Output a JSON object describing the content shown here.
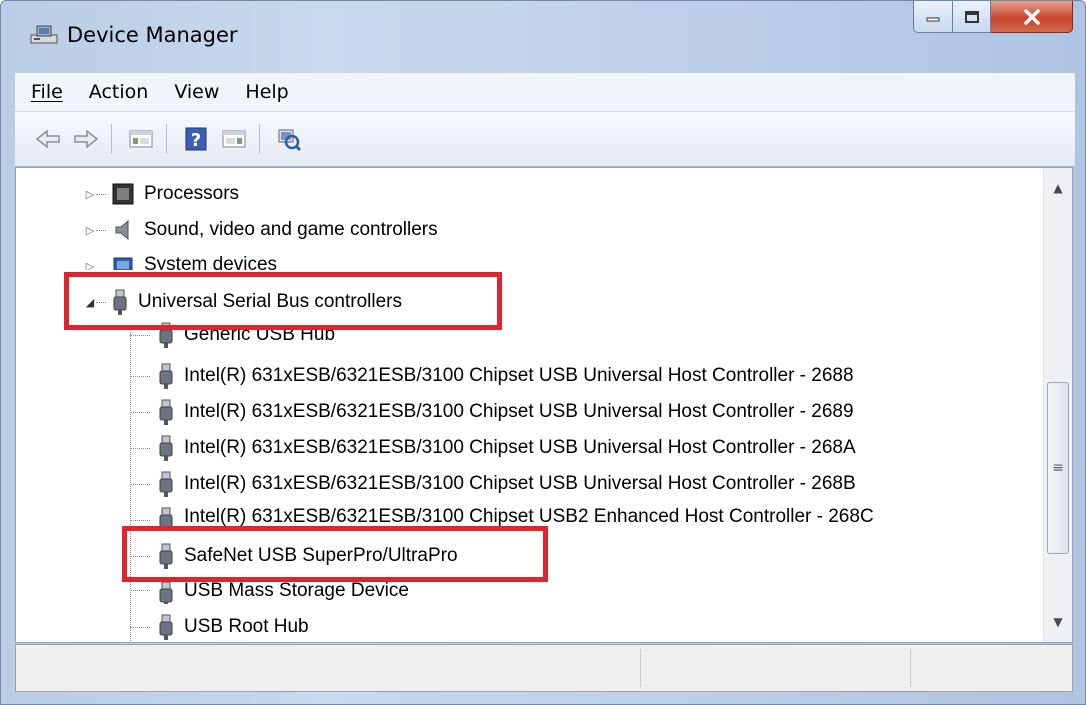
{
  "window": {
    "title": "Device Manager",
    "caption": {
      "minimize": "minimize",
      "maximize": "maximize",
      "close": "close"
    }
  },
  "menu": {
    "items": [
      "File",
      "Action",
      "View",
      "Help"
    ]
  },
  "toolbar": {
    "buttons": [
      "back-icon",
      "forward-icon",
      "properties-pane-icon",
      "help-icon",
      "show-hide-pane-icon",
      "scan-hardware-icon"
    ]
  },
  "tree": {
    "categories": [
      {
        "label": "Processors",
        "icon": "processor-icon",
        "expanded": false
      },
      {
        "label": "Sound, video and game controllers",
        "icon": "speaker-icon",
        "expanded": false
      },
      {
        "label": "System devices",
        "icon": "system-devices-icon",
        "expanded": false
      },
      {
        "label": "Universal Serial Bus controllers",
        "icon": "usb-icon",
        "expanded": true
      }
    ],
    "usb_children": [
      "Generic USB Hub",
      "Intel(R) 631xESB/6321ESB/3100 Chipset USB Universal Host Controller - 2688",
      "Intel(R) 631xESB/6321ESB/3100 Chipset USB Universal Host Controller - 2689",
      "Intel(R) 631xESB/6321ESB/3100 Chipset USB Universal Host Controller - 268A",
      "Intel(R) 631xESB/6321ESB/3100 Chipset USB Universal Host Controller - 268B",
      "Intel(R) 631xESB/6321ESB/3100 Chipset USB2 Enhanced Host Controller - 268C",
      "SafeNet USB SuperPro/UltraPro",
      "USB Mass Storage Device",
      "USB Root Hub"
    ]
  },
  "colors": {
    "highlight": "#e0242b",
    "titlebar": "#bfd1ea"
  }
}
